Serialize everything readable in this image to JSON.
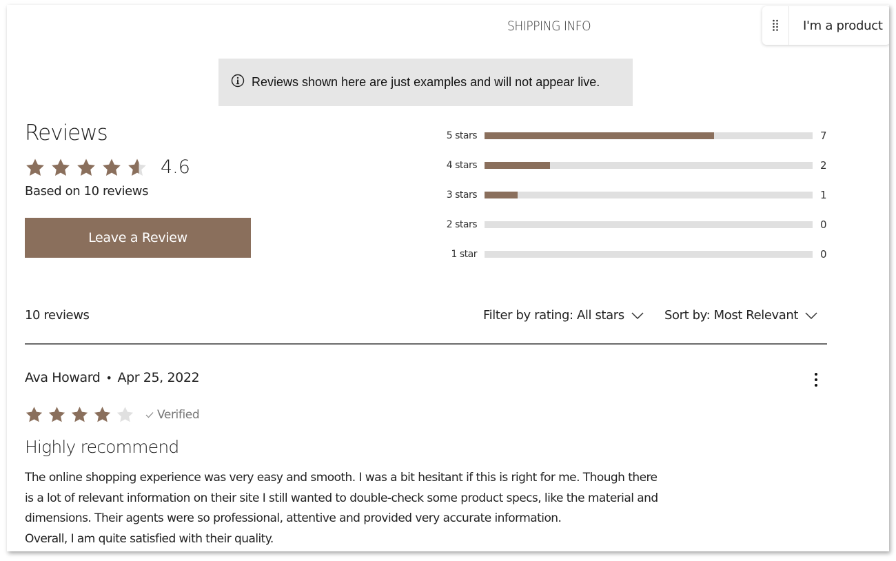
{
  "header": {
    "section_title": "SHIPPING INFO",
    "product_chip": {
      "handle_icon": "drag-handle-icon",
      "label": "I'm a product"
    }
  },
  "notice": {
    "icon": "info-icon",
    "text": "Reviews shown here are just examples and will not appear live."
  },
  "summary": {
    "title": "Reviews",
    "average_rating": 4.6,
    "average_label": "4.6",
    "max_rating": 5,
    "based_on": "Based on 10 reviews",
    "leave_review_label": "Leave a Review",
    "colors": {
      "star_filled": "#8a6f5c",
      "star_empty": "#e0e0e0",
      "button_bg": "#8a6f5c",
      "bar_track": "#e0e0e0"
    }
  },
  "distribution": {
    "total": 10,
    "rows": [
      {
        "label": "5 stars",
        "count": 7,
        "count_label": "7"
      },
      {
        "label": "4 stars",
        "count": 2,
        "count_label": "2"
      },
      {
        "label": "3 stars",
        "count": 1,
        "count_label": "1"
      },
      {
        "label": "2 stars",
        "count": 0,
        "count_label": "0"
      },
      {
        "label": "1 star",
        "count": 0,
        "count_label": "0"
      }
    ]
  },
  "list_controls": {
    "count_label": "10 reviews",
    "filter_label": "Filter by rating: All stars",
    "sort_label": "Sort by: Most Relevant"
  },
  "reviews": [
    {
      "author": "Ava Howard",
      "separator": "•",
      "date": "Apr 25, 2022",
      "rating": 4,
      "verified_label": "Verified",
      "title": "Highly recommend",
      "body_lines": [
        "The online shopping experience was very easy and smooth. I was a bit hesitant if this is right for me. Though there",
        "is a lot of relevant information on their site I still wanted to double-check some product specs, like the material and",
        "dimensions. Their agents were so professional, attentive and provided very accurate information.",
        "Overall, I am quite satisfied with their quality."
      ]
    }
  ]
}
